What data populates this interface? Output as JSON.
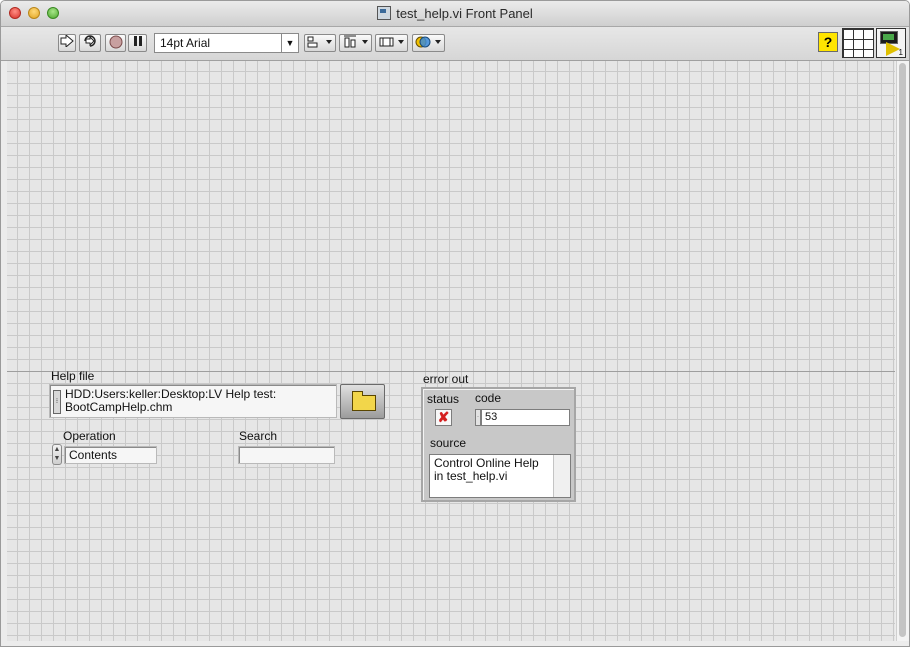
{
  "window": {
    "title": "test_help.vi Front Panel"
  },
  "toolbar": {
    "font_select": "14pt Arial",
    "help_label": "?",
    "vi_icon_number": "1"
  },
  "controls": {
    "help_file": {
      "label": "Help file",
      "value_line1": "HDD:Users:keller:Desktop:LV Help test:",
      "value_line2": "BootCampHelp.chm"
    },
    "operation": {
      "label": "Operation",
      "value": "Contents"
    },
    "search": {
      "label": "Search",
      "value": ""
    }
  },
  "error_out": {
    "label": "error out",
    "status_label": "status",
    "code_label": "code",
    "code_value": "53",
    "source_label": "source",
    "source_line1": "Control Online Help",
    "source_line2": "in test_help.vi"
  },
  "colors": {
    "panel_bg": "#e6e6e6",
    "grid": "#c9c9c9",
    "help_button": "#ffe500",
    "error_x": "#d42020"
  }
}
